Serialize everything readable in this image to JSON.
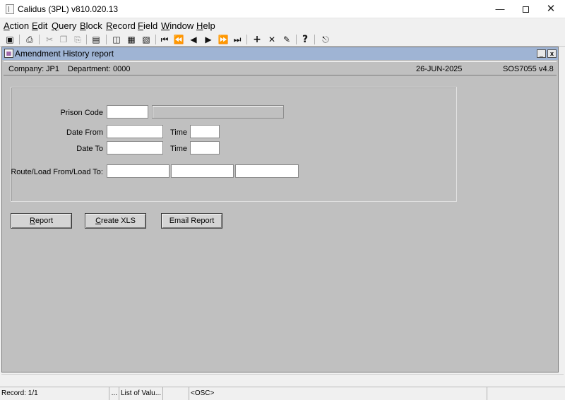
{
  "window": {
    "title": "Calidus (3PL) v810.020.13"
  },
  "menu": [
    {
      "name": "action",
      "ul": "A",
      "rest": "ction"
    },
    {
      "name": "edit",
      "ul": "E",
      "rest": "dit"
    },
    {
      "name": "query",
      "ul": "Q",
      "rest": "uery"
    },
    {
      "name": "block",
      "ul": "B",
      "rest": "lock"
    },
    {
      "name": "record",
      "ul": "R",
      "rest": "ecord"
    },
    {
      "name": "field",
      "ul": "F",
      "rest": "ield"
    },
    {
      "name": "window",
      "ul": "W",
      "rest": "indow"
    },
    {
      "name": "help",
      "ul": "H",
      "rest": "elp"
    }
  ],
  "form": {
    "title": "Amendment History report",
    "company_label": "Company:",
    "company_value": "JP1",
    "department_label": "Department:",
    "department_value": "0000",
    "date": "26-JUN-2025",
    "screen_code": "SOS7055",
    "version": "v4.8",
    "prison_code_label": "Prison Code",
    "prison_code_value": "",
    "prison_desc_value": "",
    "date_from_label": "Date From",
    "date_from_value": "",
    "time_label": "Time",
    "time_from_value": "",
    "date_to_label": "Date To",
    "date_to_value": "",
    "time_to_value": "",
    "route_label": "Route/Load From/Load To:",
    "route_value": "",
    "load_from_value": "",
    "load_to_value": ""
  },
  "buttons": {
    "report": {
      "ul": "R",
      "rest": "eport"
    },
    "create_xls": {
      "ul": "C",
      "rest": "reate XLS"
    },
    "email_report": {
      "ul": "",
      "rest": "Email Report"
    }
  },
  "status": {
    "record": "Record: 1/1",
    "ellipsis": "...",
    "list_of_values": "List of Valu...",
    "osc": "<OSC>"
  },
  "icons": [
    "save-icon",
    "print-icon",
    "cut-icon",
    "copy-icon",
    "paste-icon",
    "clear-block-icon",
    "query-icon",
    "execute-query-icon",
    "cancel-query-icon",
    "first-record-icon",
    "prev-block-icon",
    "prev-record-icon",
    "next-record-icon",
    "next-block-icon",
    "last-record-icon",
    "insert-record-icon",
    "delete-record-icon",
    "lock-record-icon",
    "help-icon",
    "exit-icon"
  ]
}
